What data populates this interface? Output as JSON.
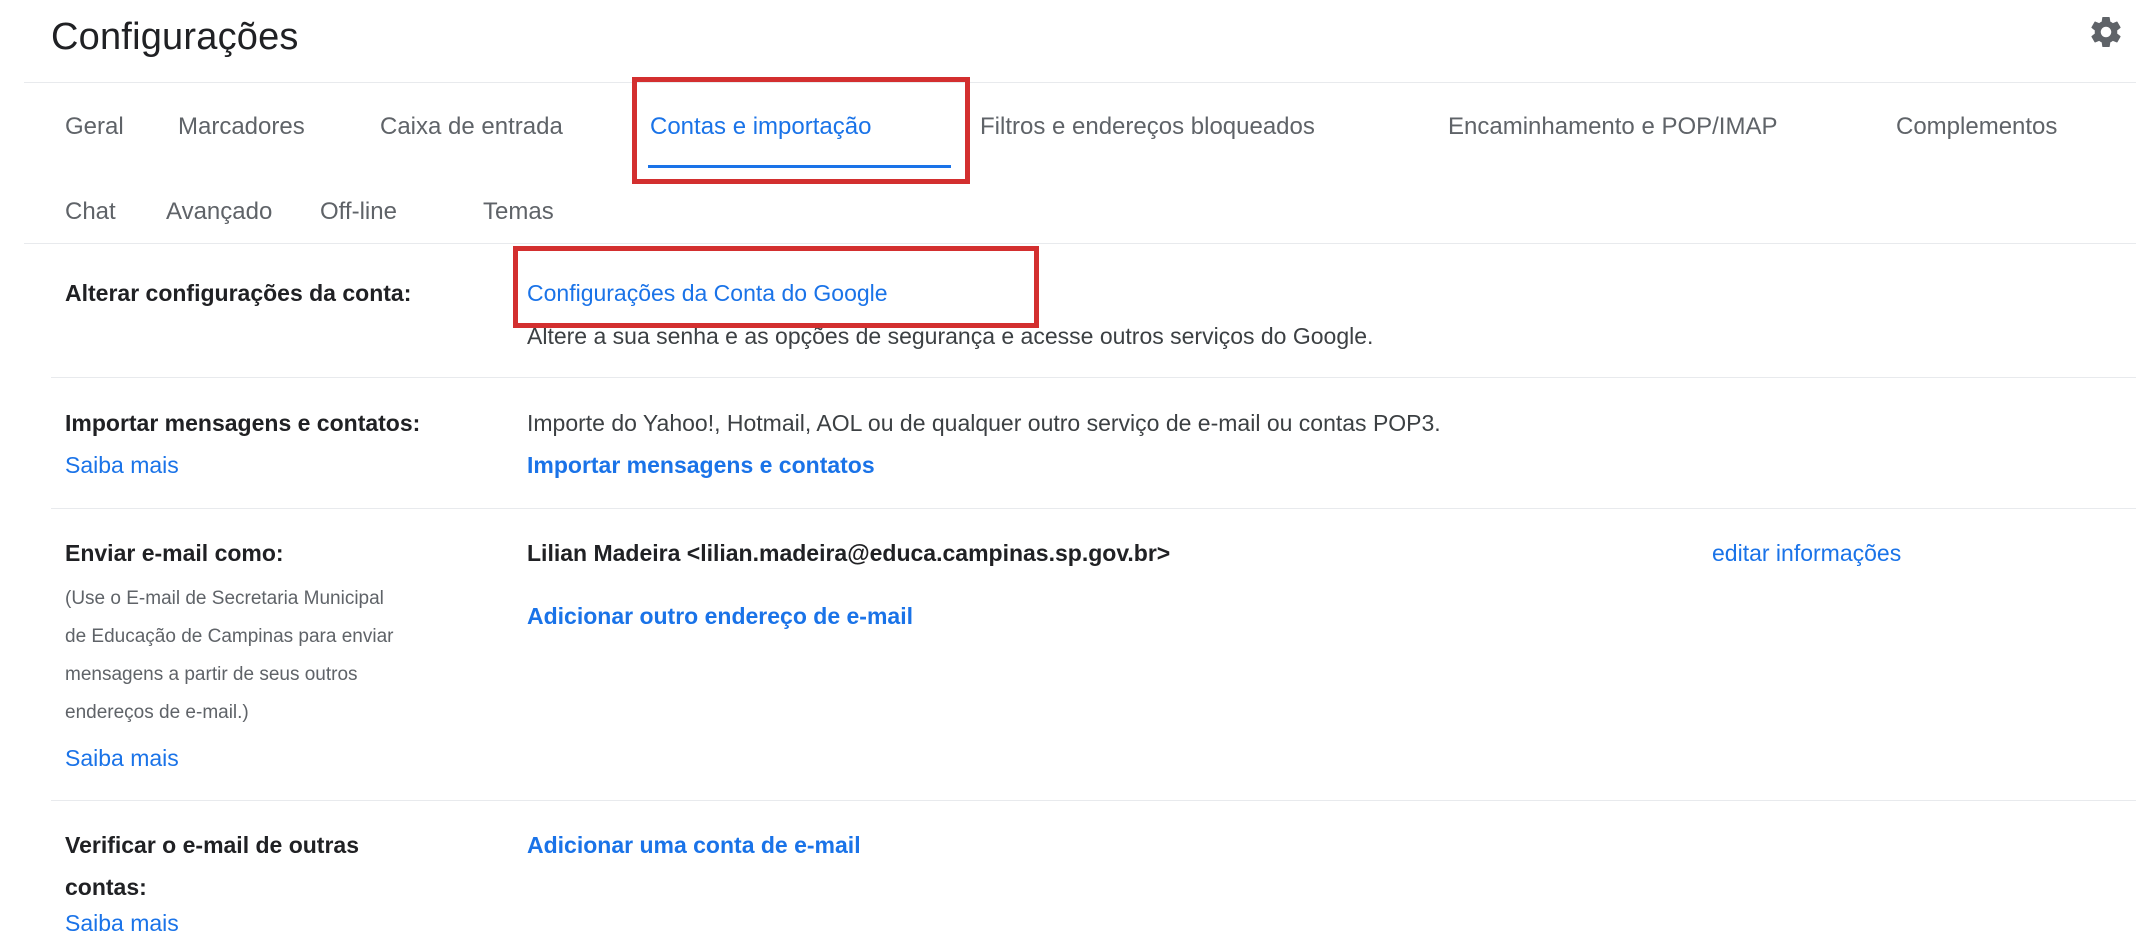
{
  "header": {
    "title": "Configurações",
    "settings_icon": "gear-icon"
  },
  "tabs": [
    {
      "label": "Geral",
      "active": false
    },
    {
      "label": "Marcadores",
      "active": false
    },
    {
      "label": "Caixa de entrada",
      "active": false
    },
    {
      "label": "Contas e importação",
      "active": true
    },
    {
      "label": "Filtros e endereços bloqueados",
      "active": false
    },
    {
      "label": "Encaminhamento e POP/IMAP",
      "active": false
    },
    {
      "label": "Complementos",
      "active": false
    },
    {
      "label": "Chat",
      "active": false
    },
    {
      "label": "Avançado",
      "active": false
    },
    {
      "label": "Off-line",
      "active": false
    },
    {
      "label": "Temas",
      "active": false
    }
  ],
  "settings": {
    "change_account": {
      "label": "Alterar configurações da conta:",
      "link": "Configurações da Conta do Google",
      "description": "Altere a sua senha e as opções de segurança e acesse outros serviços do Google."
    },
    "import": {
      "label": "Importar mensagens e contatos:",
      "learn_more": "Saiba mais",
      "description": "Importe do Yahoo!, Hotmail, AOL ou de qualquer outro serviço de e-mail ou contas POP3.",
      "action": "Importar mensagens e contatos"
    },
    "send_as": {
      "label": "Enviar e-mail como:",
      "sub_lines": [
        "(Use o E-mail de Secretaria Municipal",
        "de Educação de Campinas para enviar",
        "mensagens a partir de seus outros",
        "endereços de e-mail.)"
      ],
      "learn_more": "Saiba mais",
      "identity": "Lilian Madeira <lilian.madeira@educa.campinas.sp.gov.br>",
      "edit": "editar informações",
      "action": "Adicionar outro endereço de e-mail"
    },
    "check_other": {
      "label_line1": "Verificar o e-mail de outras",
      "label_line2": "contas:",
      "learn_more": "Saiba mais",
      "action": "Adicionar uma conta de e-mail"
    }
  },
  "colors": {
    "accent": "#1a73e8",
    "highlight": "#d32f2f",
    "text": "#202124",
    "muted": "#5f6368"
  }
}
